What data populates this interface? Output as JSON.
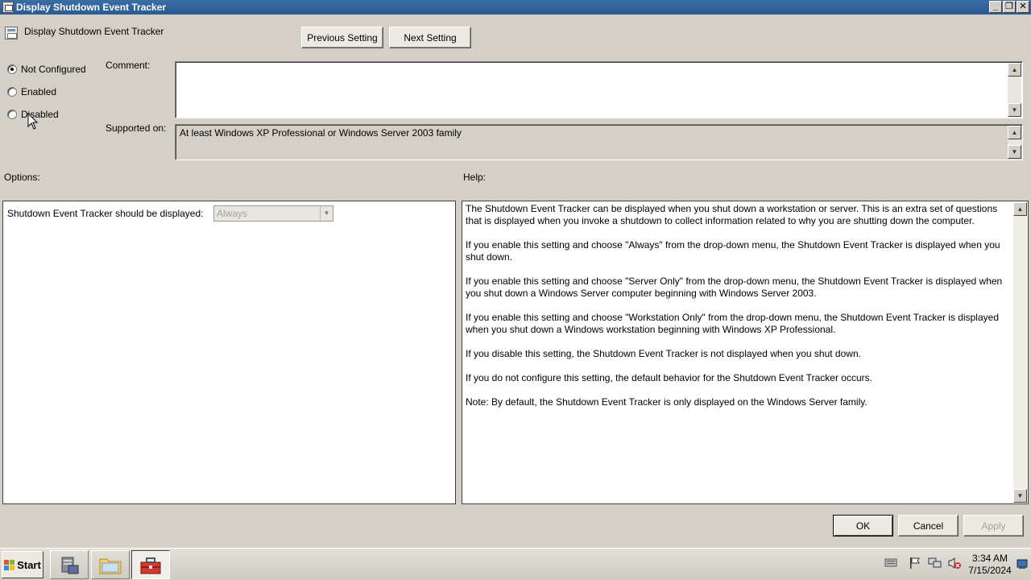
{
  "window": {
    "title": "Display Shutdown Event Tracker",
    "buttons": {
      "minimize": "_",
      "restore": "❐",
      "close": "✕"
    }
  },
  "header": {
    "title": "Display Shutdown Event Tracker",
    "previous_label": "Previous Setting",
    "next_label": "Next Setting"
  },
  "state": {
    "options": [
      "Not Configured",
      "Enabled",
      "Disabled"
    ],
    "selected": "Not Configured"
  },
  "comment": {
    "label": "Comment:",
    "value": ""
  },
  "supported": {
    "label": "Supported on:",
    "value": "At least Windows XP Professional or Windows Server 2003 family"
  },
  "options_section": {
    "label": "Options:",
    "setting_label": "Shutdown Event Tracker should be displayed:",
    "dropdown_value": "Always"
  },
  "help_section": {
    "label": "Help:",
    "paragraphs": [
      "The Shutdown Event Tracker can be displayed when you shut down a workstation or server.  This is an extra set of questions that is displayed when you invoke a shutdown to collect information related to why you are shutting down the computer.",
      "If you enable this setting and choose \"Always\" from the drop-down menu, the Shutdown Event Tracker is displayed when you shut down.",
      "If you enable this setting and choose \"Server Only\" from the drop-down menu, the Shutdown Event Tracker is displayed when you shut down a Windows Server computer beginning with Windows Server 2003.",
      "If you enable this setting and choose \"Workstation Only\" from the drop-down menu, the Shutdown Event Tracker is displayed when you shut down a Windows workstation beginning with Windows XP Professional.",
      "If you disable this setting, the Shutdown Event Tracker is not displayed when you shut down.",
      "If you do not configure this setting, the default behavior for the Shutdown Event Tracker occurs.",
      "Note: By default, the Shutdown Event Tracker is only displayed on the Windows Server family."
    ]
  },
  "footer": {
    "ok": "OK",
    "cancel": "Cancel",
    "apply": "Apply"
  },
  "taskbar": {
    "start_label": "Start",
    "time": "3:34 AM",
    "date": "7/15/2024"
  },
  "colors": {
    "titlebar": "#2b5a91",
    "dialog_bg": "#d4d0c8"
  }
}
